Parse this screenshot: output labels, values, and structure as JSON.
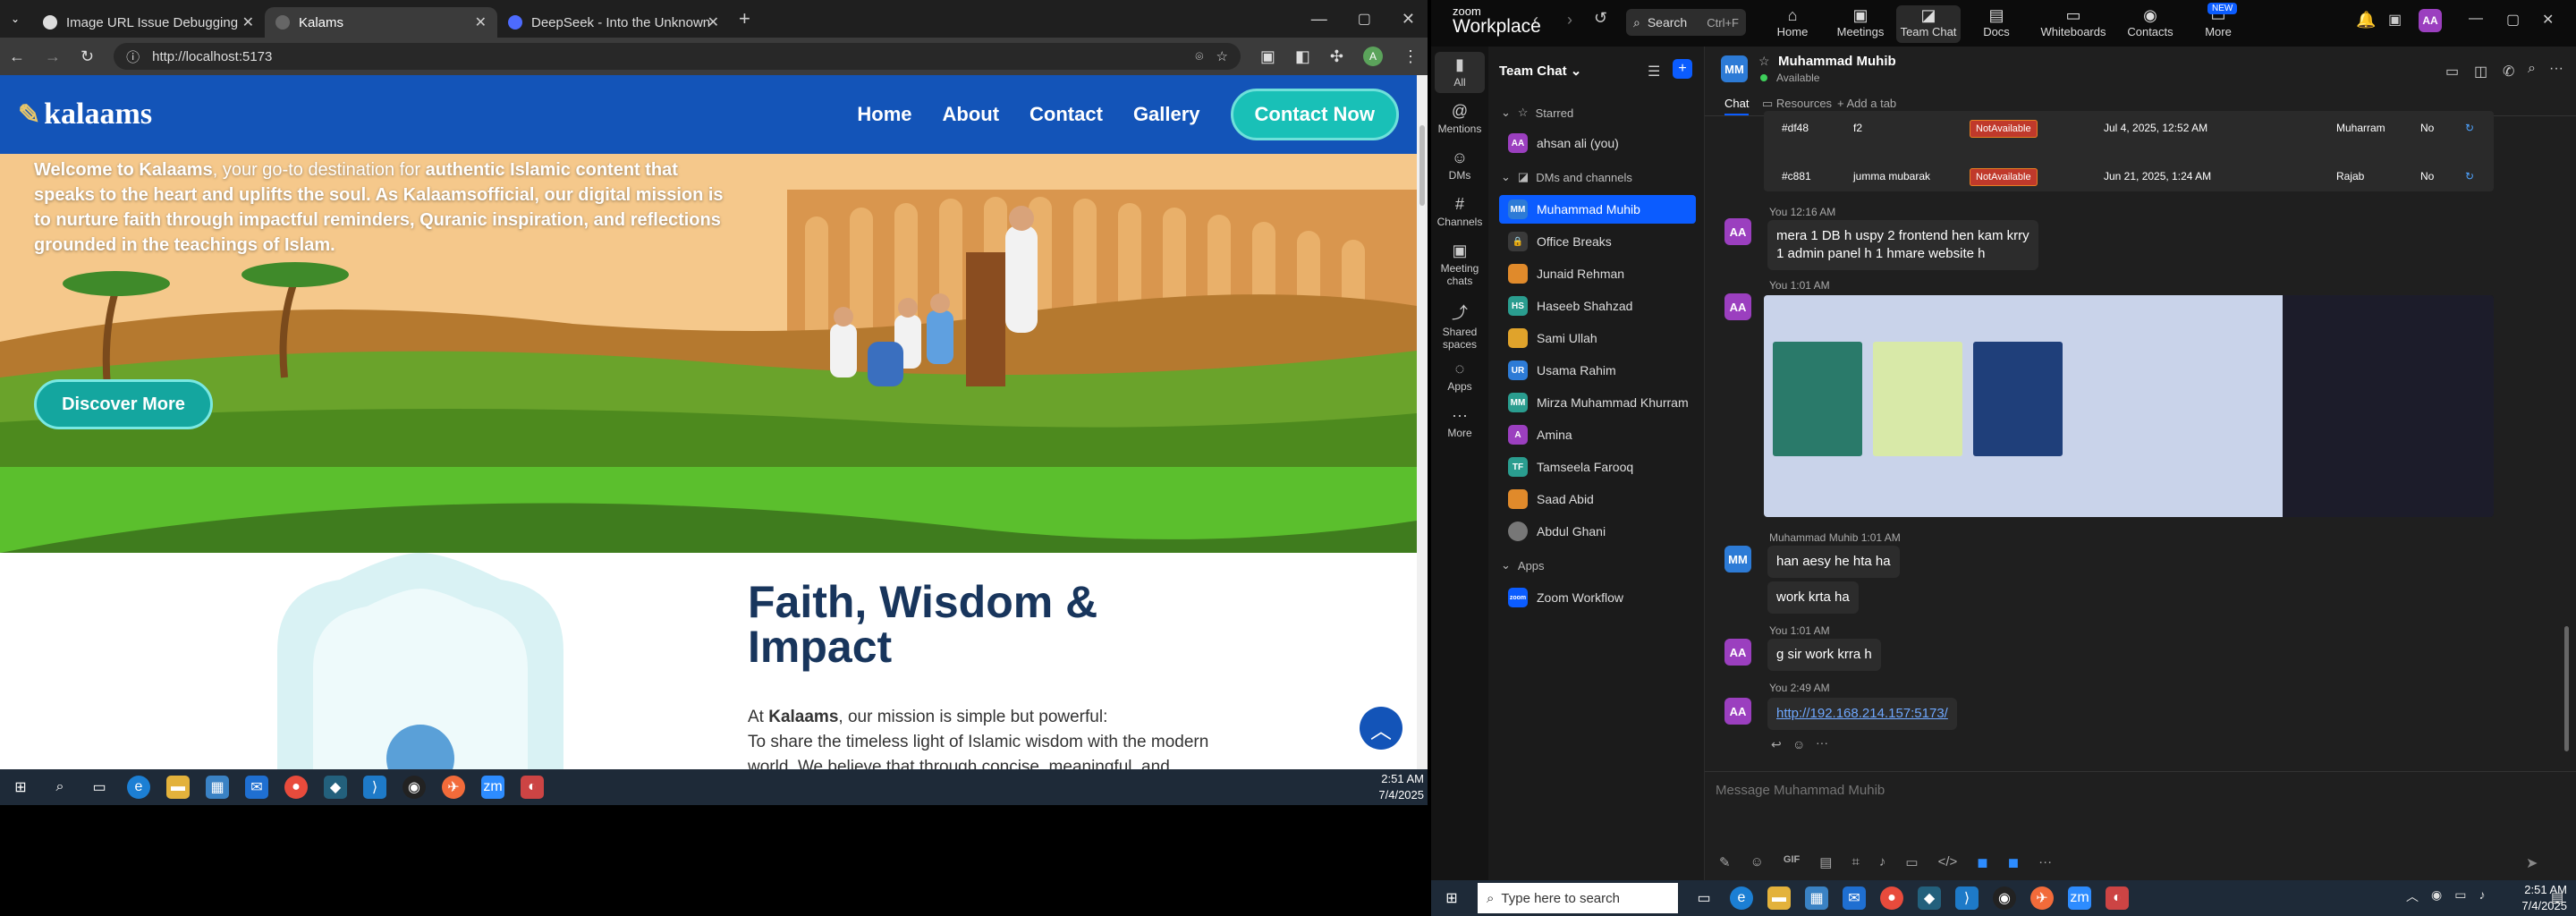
{
  "browser": {
    "tabs": [
      {
        "label": "Image URL Issue Debugging"
      },
      {
        "label": "Kalams"
      },
      {
        "label": "DeepSeek - Into the Unknown"
      }
    ],
    "url": "http://localhost:5173",
    "profile_initial": "A"
  },
  "site": {
    "logo": "kalaams",
    "nav": {
      "home": "Home",
      "about": "About",
      "contact": "Contact",
      "gallery": "Gallery",
      "cta": "Contact Now"
    },
    "hero_text_parts": {
      "p1": "Welcome to Kalaams",
      "p2": ", your go-to destination for ",
      "p3": "authentic Islamic content",
      "p4": " that speaks to the heart and uplifts the soul. As ",
      "p5": "Kalaamsofficial",
      "p6": ", our digital mission is to nurture faith through impactful reminders, Quranic inspiration, and reflections grounded in the teachings of Islam."
    },
    "discover_label": "Discover More",
    "faith_title": "Faith, Wisdom & Impact",
    "mission_prefix": "At ",
    "mission_brand": "Kalaams",
    "mission_rest": ", our mission is simple but powerful:",
    "mission_line2": "To share the timeless light of Islamic wisdom with the modern world. We believe that through concise, meaningful, and",
    "up_icon": "chevron-up-icon"
  },
  "taskbar_left": {
    "time": "2:51 AM",
    "date": "7/4/2025"
  },
  "zoom": {
    "brand_top": "zoom",
    "brand": "Workplace",
    "search_label": "Search",
    "search_shortcut": "Ctrl+F",
    "tabs": [
      {
        "label": "Home"
      },
      {
        "label": "Meetings"
      },
      {
        "label": "Team Chat"
      },
      {
        "label": "Docs"
      },
      {
        "label": "Whiteboards"
      },
      {
        "label": "Contacts"
      },
      {
        "label": "More"
      }
    ],
    "new_badge": "NEW",
    "avatar": "AA",
    "rail": [
      {
        "label": "All"
      },
      {
        "label": "Mentions"
      },
      {
        "label": "DMs"
      },
      {
        "label": "Channels"
      },
      {
        "label": "Meeting chats"
      },
      {
        "label": "Shared spaces"
      },
      {
        "label": "Apps"
      },
      {
        "label": "More"
      }
    ],
    "list_title": "Team Chat",
    "sections": {
      "starred": "Starred",
      "dms": "DMs and channels",
      "apps": "Apps"
    },
    "starred": [
      {
        "initials": "AA",
        "name": "ahsan ali (you)"
      }
    ],
    "contacts": [
      {
        "initials": "MM",
        "name": "Muhammad Muhib"
      },
      {
        "initials": "",
        "name": "Office Breaks"
      },
      {
        "initials": "",
        "name": "Junaid Rehman"
      },
      {
        "initials": "HS",
        "name": "Haseeb Shahzad"
      },
      {
        "initials": "",
        "name": "Sami Ullah"
      },
      {
        "initials": "UR",
        "name": "Usama Rahim"
      },
      {
        "initials": "MM",
        "name": "Mirza Muhammad Khurram"
      },
      {
        "initials": "A",
        "name": "Amina"
      },
      {
        "initials": "TF",
        "name": "Tamseela Farooq"
      },
      {
        "initials": "",
        "name": "Saad Abid"
      },
      {
        "initials": "",
        "name": "Abdul Ghani"
      }
    ],
    "apps": [
      {
        "initials": "zoom",
        "name": "Zoom Workflow"
      }
    ],
    "chat_header": {
      "name": "Muhammad Muhib",
      "status": "Available",
      "tab_chat": "Chat",
      "tab_resources": "Resources",
      "tab_add": "Add a tab"
    },
    "table_rows": [
      {
        "id": "#df48",
        "name": "f2",
        "status": "NotAvailable",
        "date": "Jul 4, 2025, 12:52 AM",
        "month": "Muharram",
        "flag": "No"
      },
      {
        "id": "#c881",
        "name": "jumma mubarak",
        "status": "NotAvailable",
        "date": "Jun 21, 2025, 1:24 AM",
        "month": "Rajab",
        "flag": "No"
      }
    ],
    "messages": [
      {
        "meta": "You 12:16 AM",
        "avatar": "AA",
        "text1": "mera 1 DB h uspy 2 frontend hen kam krry",
        "text2": "1 admin panel h 1 hmare website h"
      },
      {
        "meta": "You 1:01 AM",
        "avatar": "AA"
      },
      {
        "meta": "Muhammad Muhib 1:01 AM",
        "avatar": "MM",
        "text1": "han aesy he hta ha",
        "text2": "work krta ha"
      },
      {
        "meta": "You 1:01 AM",
        "avatar": "AA",
        "text1": "g sir work krra h"
      },
      {
        "meta": "You 2:49 AM",
        "avatar": "AA",
        "link": "http://192.168.214.157:5173/"
      }
    ],
    "composer_placeholder": "Message Muhammad Muhib",
    "gif_label": "GIF"
  },
  "taskbar_right": {
    "search_placeholder": "Type here to search",
    "time": "2:51 AM",
    "date": "7/4/2025"
  }
}
